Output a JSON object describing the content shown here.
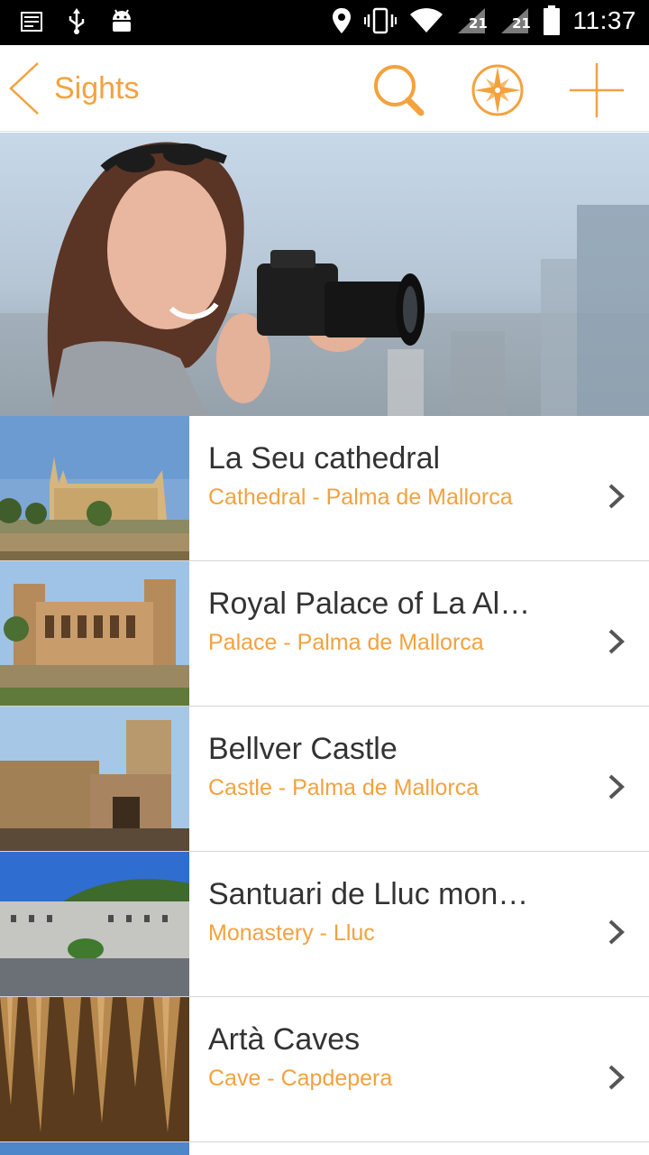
{
  "status_bar": {
    "time": "11:37",
    "left_icons": [
      "notification-icon",
      "usb-icon",
      "android-icon"
    ],
    "right_icons": [
      "location-icon",
      "vibrate-icon",
      "wifi-icon",
      "signal-sim1-icon",
      "signal-sim2-icon",
      "battery-icon"
    ]
  },
  "app_bar": {
    "title": "Sights",
    "accent_color": "#f3a23e",
    "actions": [
      "search-icon",
      "compass-icon",
      "add-icon"
    ]
  },
  "hero": {
    "image": "woman-with-camera-photo"
  },
  "sights": [
    {
      "title": "La Seu cathedral",
      "subtitle": "Cathedral - Palma de Mallorca",
      "thumbnail": "cathedral-photo"
    },
    {
      "title": "Royal Palace of La Al…",
      "subtitle": "Palace - Palma de Mallorca",
      "thumbnail": "palace-photo"
    },
    {
      "title": "Bellver Castle",
      "subtitle": "Castle - Palma de Mallorca",
      "thumbnail": "castle-photo"
    },
    {
      "title": "Santuari de Lluc mon…",
      "subtitle": "Monastery - Lluc",
      "thumbnail": "monastery-photo"
    },
    {
      "title": "Artà Caves",
      "subtitle": "Cave - Capdepera",
      "thumbnail": "cave-photo"
    }
  ]
}
